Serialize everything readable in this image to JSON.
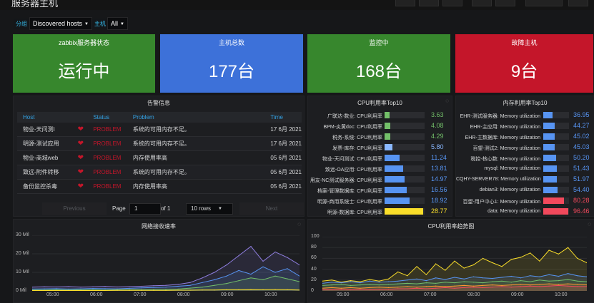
{
  "header": {
    "title": "服务器主机"
  },
  "variables": {
    "group_label": "分组",
    "group_value": "Discovered hosts",
    "host_label": "主机",
    "host_value": "All"
  },
  "stats": [
    {
      "title": "zabbix服务器状态",
      "value": "运行中",
      "color": "#37872d"
    },
    {
      "title": "主机总数",
      "value": "177台",
      "color": "#3d71d9"
    },
    {
      "title": "监控中",
      "value": "168台",
      "color": "#37872d"
    },
    {
      "title": "故障主机",
      "value": "9台",
      "color": "#c4162a"
    }
  ],
  "alerts": {
    "title": "告警信息",
    "columns": [
      "Host",
      "Status",
      "Problem",
      "Time"
    ],
    "rows": [
      {
        "host": "物业-天问测ì",
        "status": "PROBLEM",
        "problem": "系统的可用内存不足。",
        "time": "17 6月 2021"
      },
      {
        "host": "明源-测试应用",
        "status": "PROBLEM",
        "problem": "系统的可用内存不足。",
        "time": "17 6月 2021"
      },
      {
        "host": "物业-商城web",
        "status": "PROBLEM",
        "problem": "内存使用率高",
        "time": "05 6月 2021"
      },
      {
        "host": "致远-附件转移",
        "status": "PROBLEM",
        "problem": "系统的可用内存不足。",
        "time": "05 6月 2021"
      },
      {
        "host": "备份监控杀毒",
        "status": "PROBLEM",
        "problem": "内存使用率高",
        "time": "05 6月 2021"
      }
    ],
    "pager": {
      "previous": "Previous",
      "page_label": "Page",
      "page": "1",
      "of_label": "of 1",
      "rows_option": "10 rows",
      "next": "Next"
    }
  },
  "cpu_top": {
    "title": "CPU利用率Top10",
    "scale_max": 30,
    "items": [
      {
        "label": "广联达-数业: CPU利用率",
        "value": 3.63,
        "text": "3.63",
        "color": "#73bf69"
      },
      {
        "label": "BPM-炎黄doc: CPU利用率",
        "value": 4.08,
        "text": "4.08",
        "color": "#73bf69"
      },
      {
        "label": "税务-系统: CPU利用率",
        "value": 4.29,
        "text": "4.29",
        "color": "#73bf69"
      },
      {
        "label": "发票-库存: CPU利用率",
        "value": 5.8,
        "text": "5.80",
        "color": "#8ab8ff"
      },
      {
        "label": "物业-天问测试: CPU利用率",
        "value": 11.24,
        "text": "11.24",
        "color": "#5794f2"
      },
      {
        "label": "致远-OA应用: CPU利用率",
        "value": 13.81,
        "text": "13.81",
        "color": "#5794f2"
      },
      {
        "label": "用友-NC测试服务器: CPU利用率",
        "value": 14.97,
        "text": "14.97",
        "color": "#5794f2"
      },
      {
        "label": "档案-管理数据库: CPU利用率",
        "value": 16.56,
        "text": "16.56",
        "color": "#5794f2"
      },
      {
        "label": "明源-商用系统士: CPU利用率",
        "value": 18.92,
        "text": "18.92",
        "color": "#5794f2"
      },
      {
        "label": "明源-数据库: CPU利用率",
        "value": 28.77,
        "text": "28.77",
        "color": "#fade2a"
      }
    ]
  },
  "mem_top": {
    "title": "内存利用率Top10",
    "scale_max": 100,
    "items": [
      {
        "label": "EHR-测试服务器: Memory utilization",
        "value": 36.95,
        "text": "36.95",
        "color": "#5794f2"
      },
      {
        "label": "EHR-主应用: Memory utilization",
        "value": 44.27,
        "text": "44.27",
        "color": "#5794f2"
      },
      {
        "label": "EHR-主数据库: Memory utilization",
        "value": 45.02,
        "text": "45.02",
        "color": "#5794f2"
      },
      {
        "label": "百望-测试2: Memory utilization",
        "value": 45.03,
        "text": "45.03",
        "color": "#5794f2"
      },
      {
        "label": "税控-核心数: Memory utilization",
        "value": 50.2,
        "text": "50.20",
        "color": "#5794f2"
      },
      {
        "label": "mysql: Memory utilization",
        "value": 51.43,
        "text": "51.43",
        "color": "#5794f2"
      },
      {
        "label": "CQHY-SERVER78: Memory utilization",
        "value": 51.97,
        "text": "51.97",
        "color": "#5794f2"
      },
      {
        "label": "debian3: Memory utilization",
        "value": 54.4,
        "text": "54.40",
        "color": "#5794f2"
      },
      {
        "label": "百望-用户中心1: Memory utilization",
        "value": 80.28,
        "text": "80.28",
        "color": "#f2495c"
      },
      {
        "label": "data: Memory utilization",
        "value": 96.46,
        "text": "96.46",
        "color": "#f2495c"
      }
    ]
  },
  "net_chart": {
    "title": "网络接收速率",
    "y_ticks": [
      "30 Mil",
      "20 Mil",
      "10 Mil",
      "0 Mil"
    ],
    "x_ticks": [
      "05:00",
      "06:00",
      "07:00",
      "08:00",
      "09:00",
      "10:00"
    ]
  },
  "cpu_chart": {
    "title": "CPU利用率趋势图",
    "y_ticks": [
      "100",
      "80",
      "60",
      "40",
      "20",
      "0"
    ],
    "x_ticks": [
      "05:00",
      "06:00",
      "07:00",
      "08:00",
      "09:00",
      "10:00"
    ]
  },
  "chart_data": [
    {
      "type": "line",
      "title": "网络接收速率",
      "x": [
        "04:20",
        "04:40",
        "05:00",
        "05:20",
        "05:40",
        "06:00",
        "06:20",
        "06:40",
        "07:00",
        "07:20",
        "07:40",
        "08:00",
        "08:20",
        "08:40",
        "09:00",
        "09:10",
        "09:20",
        "09:30",
        "09:40",
        "09:50",
        "10:00",
        "10:10",
        "10:20"
      ],
      "ylim": [
        0,
        30
      ],
      "series": [
        {
          "values": [
            2.0,
            2.2,
            2.1,
            2.3,
            2.0,
            2.2,
            2.4,
            2.1,
            2.3,
            2.5,
            2.8,
            3.0,
            3.5,
            4.5,
            7.0,
            10.0,
            14.0,
            19.0,
            24.0,
            16.0,
            21.0,
            18.0,
            14.0
          ],
          "color": "#8f7ee0"
        },
        {
          "values": [
            1.0,
            1.1,
            1.2,
            1.0,
            1.1,
            1.3,
            1.2,
            1.1,
            1.4,
            1.6,
            1.8,
            2.0,
            2.5,
            3.0,
            4.5,
            6.0,
            8.0,
            11.0,
            9.0,
            13.0,
            10.0,
            12.0,
            8.0
          ],
          "color": "#5794f2"
        },
        {
          "values": [
            0.5,
            0.5,
            0.6,
            0.5,
            0.6,
            0.6,
            0.5,
            0.6,
            0.7,
            0.7,
            0.8,
            0.9,
            1.0,
            1.5,
            2.0,
            3.0,
            4.0,
            5.5,
            7.0,
            6.0,
            8.0,
            6.5,
            5.0
          ],
          "color": "#73bf69"
        },
        {
          "values": [
            0.2,
            0.2,
            0.2,
            0.2,
            0.2,
            0.2,
            0.2,
            0.3,
            0.3,
            0.3,
            0.3,
            0.3,
            0.4,
            0.4,
            0.5,
            0.5,
            0.6,
            0.6,
            0.7,
            0.6,
            0.7,
            0.6,
            0.5
          ],
          "color": "#fade2a"
        }
      ]
    },
    {
      "type": "line",
      "title": "CPU利用率趋势图",
      "x": [
        "04:20",
        "04:40",
        "05:00",
        "05:20",
        "05:40",
        "06:00",
        "06:20",
        "06:40",
        "07:00",
        "07:10",
        "07:20",
        "07:30",
        "07:40",
        "07:50",
        "08:00",
        "08:10",
        "08:20",
        "08:30",
        "08:40",
        "08:50",
        "09:00",
        "09:10",
        "09:20",
        "09:30",
        "09:40",
        "09:50",
        "10:00",
        "10:10",
        "10:20"
      ],
      "ylim": [
        0,
        100
      ],
      "series": [
        {
          "values": [
            18,
            20,
            16,
            19,
            17,
            21,
            18,
            22,
            35,
            28,
            45,
            30,
            50,
            38,
            55,
            42,
            48,
            60,
            52,
            45,
            58,
            62,
            70,
            55,
            75,
            68,
            80,
            60,
            52
          ],
          "color": "#fade2a"
        },
        {
          "values": [
            14,
            16,
            15,
            17,
            15,
            18,
            16,
            17,
            18,
            20,
            22,
            19,
            24,
            21,
            25,
            22,
            26,
            24,
            23,
            25,
            27,
            24,
            28,
            26,
            30,
            27,
            32,
            28,
            26
          ],
          "color": "#5794f2"
        },
        {
          "values": [
            10,
            11,
            12,
            10,
            11,
            12,
            11,
            12,
            13,
            14,
            13,
            15,
            14,
            16,
            15,
            17,
            16,
            15,
            17,
            18,
            16,
            19,
            17,
            20,
            18,
            19,
            21,
            18,
            17
          ],
          "color": "#73bf69"
        },
        {
          "values": [
            5,
            6,
            5,
            6,
            5,
            6,
            7,
            6,
            7,
            8,
            7,
            8,
            9,
            8,
            9,
            10,
            9,
            10,
            11,
            10,
            11,
            12,
            11,
            12,
            13,
            12,
            13,
            12,
            11
          ],
          "color": "#ff9830"
        },
        {
          "values": [
            2,
            2,
            3,
            2,
            3,
            2,
            3,
            3,
            4,
            4,
            5,
            4,
            5,
            6,
            5,
            6,
            7,
            6,
            7,
            8,
            7,
            8,
            9,
            8,
            9,
            10,
            9,
            8,
            8
          ],
          "color": "#f2495c"
        }
      ]
    }
  ]
}
